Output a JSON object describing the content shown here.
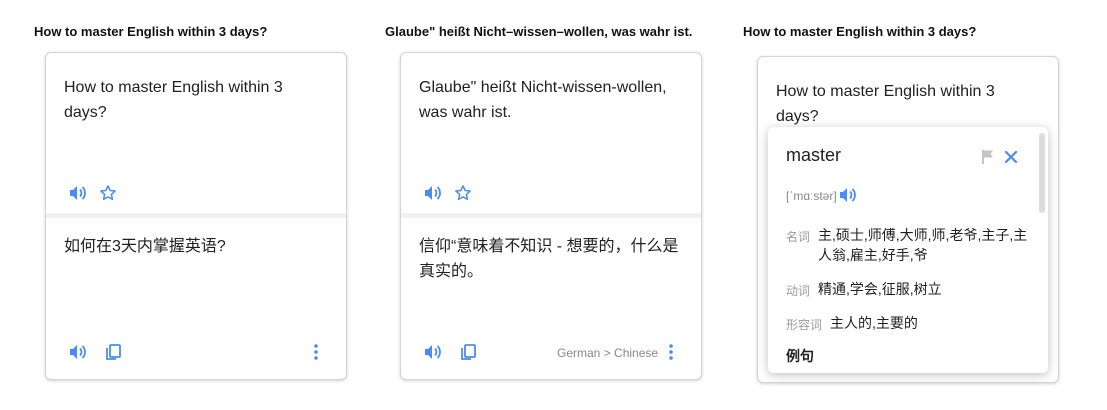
{
  "panels": [
    {
      "title": "How to master English within 3 days?",
      "source_text": "How to master English within 3 days?",
      "target_text": "如何在3天内掌握英语?",
      "lang_label": ""
    },
    {
      "title": "Glaube\" heißt Nicht–wissen–wollen, was wahr ist.",
      "source_text": "Glaube\" heißt Nicht-wissen-wollen, was wahr ist.",
      "target_text": "信仰“意味着不知识 - 想要的，什么是真实的。",
      "lang_label": "German > Chinese"
    },
    {
      "title": "How to master English within 3 days?",
      "source_text": "How to master English within 3 days?"
    }
  ],
  "dictionary": {
    "word": "master",
    "phonetic": "[ˈmɑːstər]",
    "entries": [
      {
        "pos": "名词",
        "meaning": "主,硕士,师傅,大师,师,老爷,主子,主人翁,雇主,好手,爷"
      },
      {
        "pos": "动词",
        "meaning": "精通,学会,征服,树立"
      },
      {
        "pos": "形容词",
        "meaning": "主人的,主要的"
      }
    ],
    "examples_label": "例句"
  },
  "colors": {
    "accent": "#4a8cf0",
    "icon_gray": "#c4c4c4"
  },
  "icons": [
    "speaker-icon",
    "star-icon",
    "copy-icon",
    "more-vert-icon",
    "flag-icon",
    "close-icon"
  ]
}
